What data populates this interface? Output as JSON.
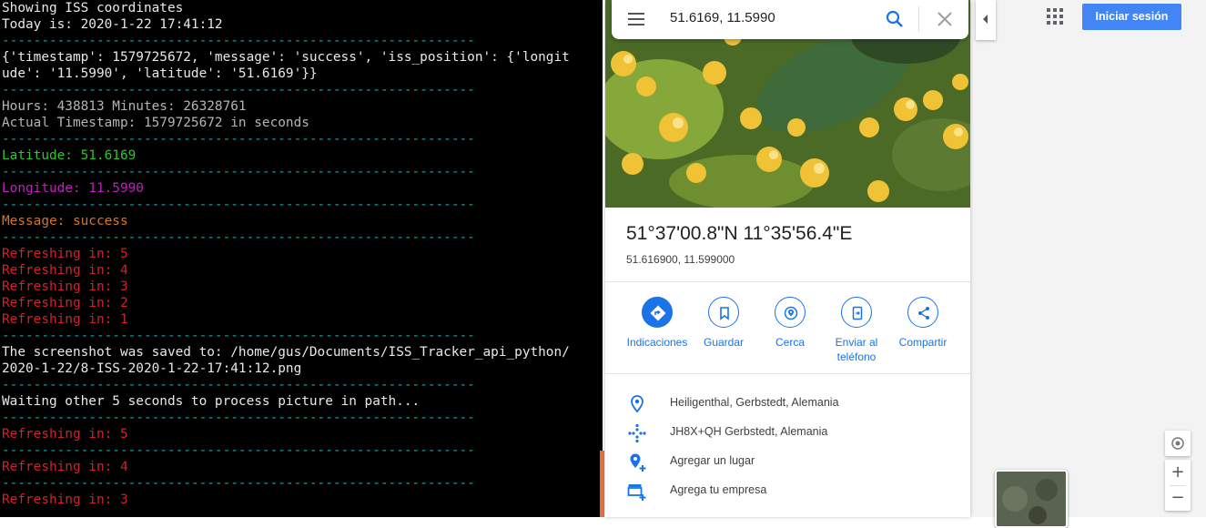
{
  "terminal": {
    "lines": [
      {
        "t": "Showing ISS coordinates",
        "c": "white"
      },
      {
        "t": "Today is: 2020-1-22 17:41:12",
        "c": "white"
      },
      {
        "t": "------------------------------------------------------------",
        "c": "cyan"
      },
      {
        "t": "{'timestamp': 1579725672, 'message': 'success', 'iss_position': {'longit",
        "c": "white"
      },
      {
        "t": "ude': '11.5990', 'latitude': '51.6169'}}",
        "c": "white"
      },
      {
        "t": "------------------------------------------------------------",
        "c": "cyan"
      },
      {
        "t": "Hours: 438813 Minutes: 26328761",
        "c": "gray"
      },
      {
        "t": "Actual Timestamp: 1579725672 in seconds",
        "c": "gray"
      },
      {
        "t": "------------------------------------------------------------",
        "c": "cyan"
      },
      {
        "t": "Latitude: 51.6169",
        "c": "green"
      },
      {
        "t": "------------------------------------------------------------",
        "c": "cyan"
      },
      {
        "t": "Longitude: 11.5990",
        "c": "magenta"
      },
      {
        "t": "------------------------------------------------------------",
        "c": "cyan"
      },
      {
        "t": "Message: success",
        "c": "orange"
      },
      {
        "t": "------------------------------------------------------------",
        "c": "cyan"
      },
      {
        "t": "Refreshing in: 5",
        "c": "red"
      },
      {
        "t": "Refreshing in: 4",
        "c": "red"
      },
      {
        "t": "Refreshing in: 3",
        "c": "red"
      },
      {
        "t": "Refreshing in: 2",
        "c": "red"
      },
      {
        "t": "Refreshing in: 1",
        "c": "red"
      },
      {
        "t": "------------------------------------------------------------",
        "c": "cyan"
      },
      {
        "t": "The screenshot was saved to: /home/gus/Documents/ISS_Tracker_api_python/",
        "c": "white"
      },
      {
        "t": "2020-1-22/8-ISS-2020-1-22-17:41:12.png",
        "c": "white"
      },
      {
        "t": "------------------------------------------------------------",
        "c": "cyan"
      },
      {
        "t": "Waiting other 5 seconds to process picture in path...",
        "c": "white"
      },
      {
        "t": "------------------------------------------------------------",
        "c": "cyan"
      },
      {
        "t": "Refreshing in: 5",
        "c": "red"
      },
      {
        "t": "------------------------------------------------------------",
        "c": "cyan"
      },
      {
        "t": "Refreshing in: 4",
        "c": "red"
      },
      {
        "t": "------------------------------------------------------------",
        "c": "cyan"
      },
      {
        "t": "Refreshing in: 3",
        "c": "red"
      }
    ]
  },
  "search": {
    "value": "51.6169, 11.5990"
  },
  "place": {
    "title": "51°37'00.8\"N 11°35'56.4\"E",
    "decimal": "51.616900, 11.599000"
  },
  "actions": [
    {
      "label": "Indicaciones",
      "icon": "directions-icon"
    },
    {
      "label": "Guardar",
      "icon": "bookmark-icon"
    },
    {
      "label": "Cerca",
      "icon": "nearby-icon"
    },
    {
      "label": "Enviar al teléfono",
      "icon": "send-to-phone-icon"
    },
    {
      "label": "Compartir",
      "icon": "share-icon"
    }
  ],
  "info": [
    {
      "text": "Heiligenthal, Gerbstedt, Alemania",
      "icon": "location-pin-icon"
    },
    {
      "text": "JH8X+QH Gerbstedt, Alemania",
      "icon": "plus-code-icon"
    },
    {
      "text": "Agregar un lugar",
      "icon": "add-place-icon"
    },
    {
      "text": "Agrega tu empresa",
      "icon": "add-business-icon"
    }
  ],
  "header": {
    "signin_label": "Iniciar sesión"
  },
  "map_controls": {
    "zoom_in": "+",
    "zoom_out": "−"
  },
  "colors": {
    "accent": "#1a73e8",
    "signin": "#4285f4",
    "terminal_bg": "#000000"
  }
}
